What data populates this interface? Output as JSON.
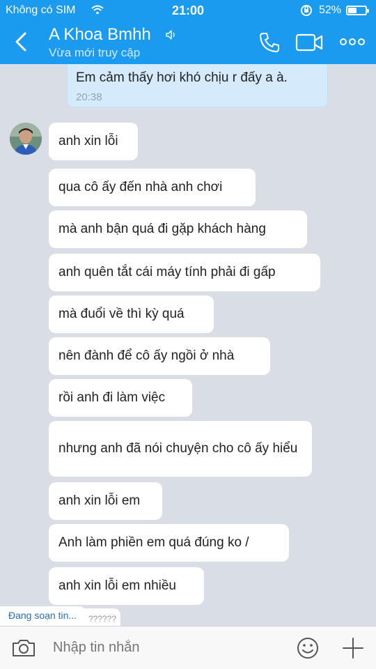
{
  "status_bar": {
    "carrier": "Không có SIM",
    "time": "21:00",
    "battery_percent": "52%",
    "battery_level": 0.52
  },
  "header": {
    "title": "A Khoa Bmhh",
    "subtitle": "Vừa mới truy cập",
    "icons": [
      "back-icon",
      "mute-icon",
      "phone-icon",
      "video-icon",
      "more-icon"
    ],
    "accent_color": "#1a9bf0"
  },
  "messages": {
    "outgoing": {
      "text": "Em cảm thấy hơi khó chịu r đấy a à.",
      "time": "20:38"
    },
    "incoming": [
      "anh xin lỗi",
      "qua cô ấy đến nhà anh chơi",
      "mà anh bận quá đi gặp khách hàng",
      "anh quên tắt cái máy tính phải đi gấp",
      "mà đuổi về thì kỳ quá",
      "nên đành để cô ấy ngồi ở nhà",
      "rồi anh đi làm việc",
      "nhưng anh đã nói chuyện cho cô ấy hiểu",
      "anh xin lỗi em",
      "Anh làm phiền em quá đúng ko /",
      "anh xin lỗi em nhiều"
    ],
    "typing_indicator": "Đang soạn tin...",
    "partial_message": "??????"
  },
  "composer": {
    "placeholder": "Nhập tin nhắn",
    "icons": [
      "camera-icon",
      "emoji-icon",
      "plus-icon"
    ]
  }
}
